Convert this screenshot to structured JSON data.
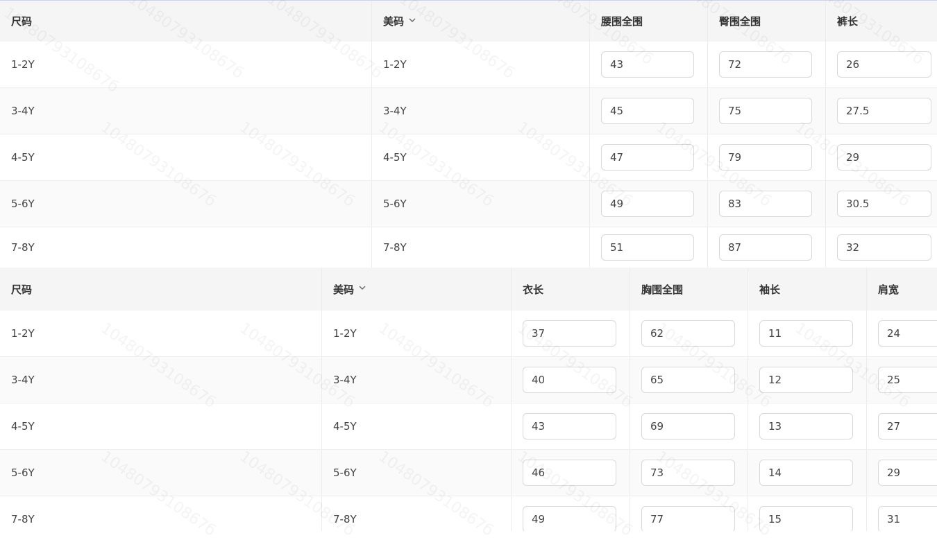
{
  "table1": {
    "headers": [
      "尺码",
      "美码",
      "腰围全围",
      "臀围全围",
      "裤长"
    ],
    "rows": [
      {
        "size": "1-2Y",
        "us": "1-2Y",
        "values": [
          "43",
          "72",
          "26"
        ]
      },
      {
        "size": "3-4Y",
        "us": "3-4Y",
        "values": [
          "45",
          "75",
          "27.5"
        ]
      },
      {
        "size": "4-5Y",
        "us": "4-5Y",
        "values": [
          "47",
          "79",
          "29"
        ]
      },
      {
        "size": "5-6Y",
        "us": "5-6Y",
        "values": [
          "49",
          "83",
          "30.5"
        ]
      },
      {
        "size": "7-8Y",
        "us": "7-8Y",
        "values": [
          "51",
          "87",
          "32"
        ]
      }
    ]
  },
  "table2": {
    "headers": [
      "尺码",
      "美码",
      "衣长",
      "胸围全围",
      "袖长",
      "肩宽"
    ],
    "rows": [
      {
        "size": "1-2Y",
        "us": "1-2Y",
        "values": [
          "37",
          "62",
          "11",
          "24"
        ]
      },
      {
        "size": "3-4Y",
        "us": "3-4Y",
        "values": [
          "40",
          "65",
          "12",
          "25"
        ]
      },
      {
        "size": "4-5Y",
        "us": "4-5Y",
        "values": [
          "43",
          "69",
          "13",
          "27"
        ]
      },
      {
        "size": "5-6Y",
        "us": "5-6Y",
        "values": [
          "46",
          "73",
          "14",
          "29"
        ]
      },
      {
        "size": "7-8Y",
        "us": "7-8Y",
        "values": [
          "49",
          "77",
          "15",
          "31"
        ]
      }
    ]
  },
  "watermark": "1048079310867б",
  "icons": {
    "dropdown": "chevron-down-icon"
  },
  "colors": {
    "header_bg": "#f5f5f5",
    "row_alt_bg": "#fafafa",
    "border": "#d9d9d9"
  }
}
